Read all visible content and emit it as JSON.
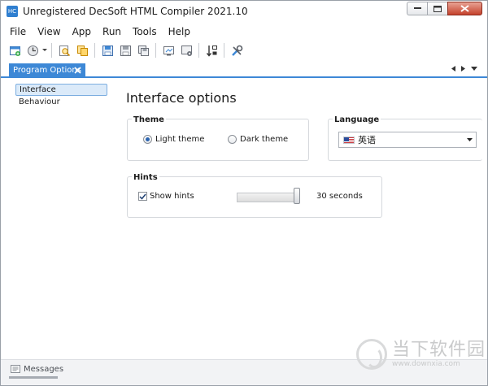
{
  "window": {
    "title": "Unregistered DecSoft HTML Compiler 2021.10",
    "app_icon_text": "HC"
  },
  "menu": [
    "File",
    "View",
    "App",
    "Run",
    "Tools",
    "Help"
  ],
  "toolbar": {
    "buttons": [
      "new-project-icon",
      "open-project-icon",
      "dropdown-arrow-icon",
      "find-icon",
      "find-replace-icon",
      "save-icon",
      "save-as-icon",
      "save-all-icon",
      "preview-icon",
      "build-icon",
      "sort-icon",
      "tools-icon"
    ]
  },
  "tabs": [
    {
      "label": "Program Options",
      "active": true
    }
  ],
  "sidebar": {
    "items": [
      {
        "label": "Interface",
        "selected": true
      },
      {
        "label": "Behaviour",
        "selected": false
      }
    ]
  },
  "content": {
    "title": "Interface options",
    "theme": {
      "label": "Theme",
      "options": [
        {
          "label": "Light theme",
          "checked": true
        },
        {
          "label": "Dark theme",
          "checked": false
        }
      ]
    },
    "language": {
      "label": "Language",
      "value": "英语"
    },
    "hints": {
      "label": "Hints",
      "show_hints_label": "Show hints",
      "show_hints_checked": true,
      "slider_fraction": 1.0,
      "slider_value": "30 seconds"
    }
  },
  "bottom": {
    "messages_label": "Messages"
  },
  "watermark": {
    "text_cn": "当下软件园",
    "text_en": "www.downxia.com"
  },
  "colors": {
    "accent": "#3d88d6",
    "selection_bg": "#dbeaf9",
    "close_button": "#c4412c"
  }
}
